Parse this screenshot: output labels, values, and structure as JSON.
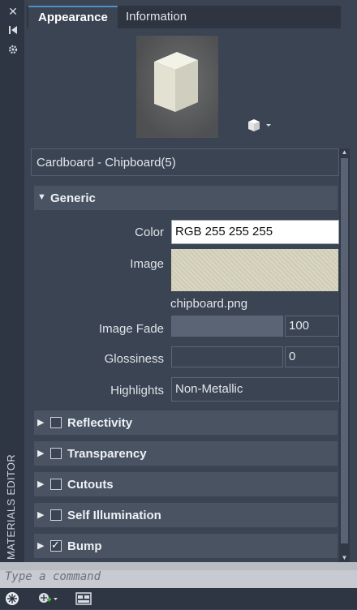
{
  "side_title": "MATERIALS EDITOR",
  "left_icons": [
    "close-icon",
    "collapse-icon",
    "settings-icon"
  ],
  "tabs": {
    "appearance": "Appearance",
    "information": "Information"
  },
  "material_name": "Cardboard - Chipboard(5)",
  "generic": {
    "title": "Generic",
    "color_label": "Color",
    "color_value": "RGB 255 255 255",
    "image_label": "Image",
    "image_file": "chipboard.png",
    "image_fade_label": "Image Fade",
    "image_fade_value": "100",
    "glossiness_label": "Glossiness",
    "glossiness_value": "0",
    "highlights_label": "Highlights",
    "highlights_value": "Non-Metallic"
  },
  "sections": [
    {
      "label": "Reflectivity",
      "checked": false
    },
    {
      "label": "Transparency",
      "checked": false
    },
    {
      "label": "Cutouts",
      "checked": false
    },
    {
      "label": "Self Illumination",
      "checked": false
    },
    {
      "label": "Bump",
      "checked": true
    }
  ],
  "command_placeholder": "Type a command",
  "colors": {
    "accent": "#4b93c4",
    "panel": "#3b4453",
    "section": "#4a5362"
  }
}
